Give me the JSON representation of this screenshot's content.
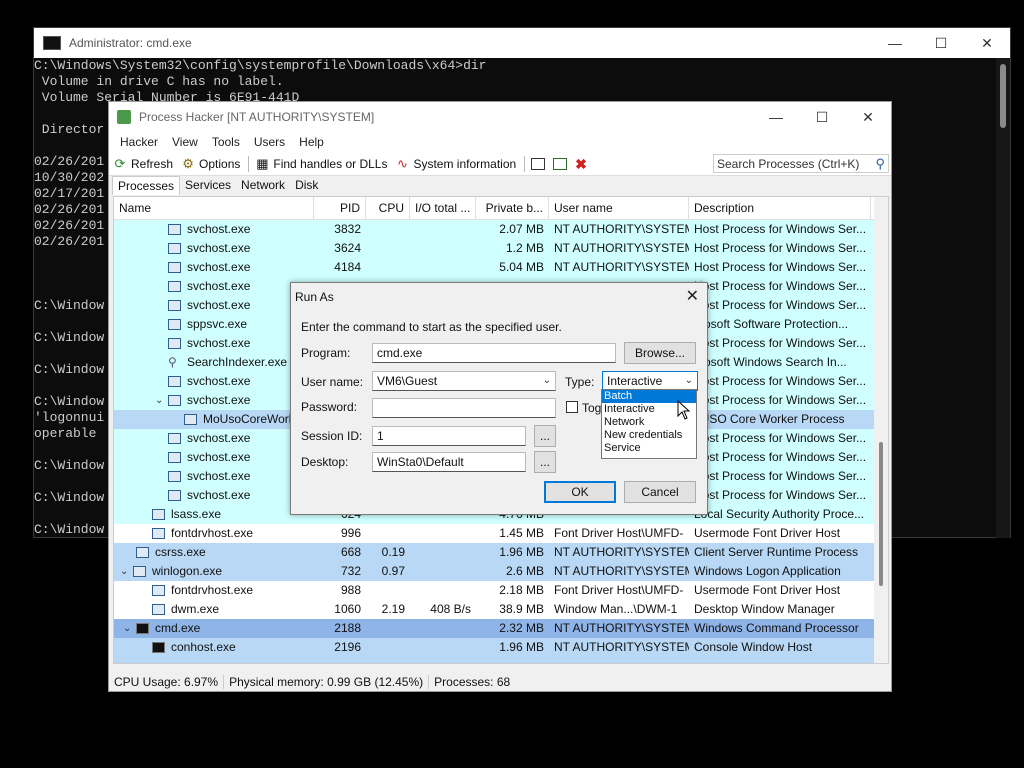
{
  "cmd": {
    "title": "Administrator: cmd.exe",
    "lines": [
      "C:\\Windows\\System32\\config\\systemprofile\\Downloads\\x64>dir",
      " Volume in drive C has no label.",
      " Volume Serial Number is 6E91-441D",
      "",
      " Director",
      "",
      "02/26/201",
      "10/30/202",
      "02/17/201",
      "02/26/201",
      "02/26/201",
      "02/26/201",
      "",
      "",
      "",
      "C:\\Window",
      "",
      "C:\\Window",
      "",
      "C:\\Window",
      "",
      "C:\\Window",
      "'logonnui",
      "operable ",
      "",
      "C:\\Window",
      "",
      "C:\\Window",
      "",
      "C:\\Window"
    ]
  },
  "ph": {
    "title": "Process Hacker [NT AUTHORITY\\SYSTEM]",
    "menu": [
      "Hacker",
      "View",
      "Tools",
      "Users",
      "Help"
    ],
    "toolbar": {
      "refresh": "Refresh",
      "options": "Options",
      "find_handles": "Find handles or DLLs",
      "system_info": "System information"
    },
    "search_placeholder": "Search Processes (Ctrl+K)",
    "tabs": [
      "Processes",
      "Services",
      "Network",
      "Disk"
    ],
    "columns": [
      "Name",
      "PID",
      "CPU",
      "I/O total ...",
      "Private b...",
      "User name",
      "Description"
    ],
    "rows": [
      {
        "name": "svchost.exe",
        "pid": "3832",
        "cpu": "",
        "io": "",
        "priv": "2.07 MB",
        "user": "NT AUTHORITY\\SYSTEM",
        "desc": "Host Process for Windows Ser...",
        "indent": 3,
        "bg": "#cfffff",
        "icon": "box"
      },
      {
        "name": "svchost.exe",
        "pid": "3624",
        "cpu": "",
        "io": "",
        "priv": "1.2 MB",
        "user": "NT AUTHORITY\\SYSTEM",
        "desc": "Host Process for Windows Ser...",
        "indent": 3,
        "bg": "#cfffff",
        "icon": "box"
      },
      {
        "name": "svchost.exe",
        "pid": "4184",
        "cpu": "",
        "io": "",
        "priv": "5.04 MB",
        "user": "NT AUTHORITY\\SYSTEM",
        "desc": "Host Process for Windows Ser...",
        "indent": 3,
        "bg": "#cfffff",
        "icon": "box"
      },
      {
        "name": "svchost.exe",
        "pid": "",
        "cpu": "",
        "io": "",
        "priv": "",
        "user": "",
        "desc": "Host Process for Windows Ser...",
        "indent": 3,
        "bg": "#cfffff",
        "icon": "box"
      },
      {
        "name": "svchost.exe",
        "pid": "",
        "cpu": "",
        "io": "",
        "priv": "",
        "user": "",
        "desc": "Host Process for Windows Ser...",
        "indent": 3,
        "bg": "#cfffff",
        "icon": "box"
      },
      {
        "name": "sppsvc.exe",
        "pid": "",
        "cpu": "",
        "io": "",
        "priv": "",
        "user": "",
        "desc": "crosoft Software Protection...",
        "indent": 3,
        "bg": "#cfffff",
        "icon": "box"
      },
      {
        "name": "svchost.exe",
        "pid": "",
        "cpu": "",
        "io": "",
        "priv": "",
        "user": "",
        "desc": "Host Process for Windows Ser...",
        "indent": 3,
        "bg": "#cfffff",
        "icon": "box"
      },
      {
        "name": "SearchIndexer.exe",
        "pid": "",
        "cpu": "",
        "io": "",
        "priv": "",
        "user": "",
        "desc": "crosoft Windows Search In...",
        "indent": 3,
        "bg": "#cfffff",
        "icon": "mag"
      },
      {
        "name": "svchost.exe",
        "pid": "",
        "cpu": "",
        "io": "",
        "priv": "",
        "user": "",
        "desc": "Host Process for Windows Ser...",
        "indent": 3,
        "bg": "#cfffff",
        "icon": "box"
      },
      {
        "name": "svchost.exe",
        "pid": "",
        "cpu": "",
        "io": "",
        "priv": "",
        "user": "",
        "desc": "Host Process for Windows Ser...",
        "indent": 3,
        "bg": "#cfffff",
        "icon": "box",
        "expanded": true
      },
      {
        "name": "MoUsoCoreWork",
        "pid": "",
        "cpu": "",
        "io": "",
        "priv": "",
        "user": "",
        "desc": "oUSO Core Worker Process",
        "indent": 4,
        "bg": "#b8d8f5",
        "icon": "box"
      },
      {
        "name": "svchost.exe",
        "pid": "",
        "cpu": "",
        "io": "",
        "priv": "",
        "user": "",
        "desc": "Host Process for Windows Ser...",
        "indent": 3,
        "bg": "#cfffff",
        "icon": "box"
      },
      {
        "name": "svchost.exe",
        "pid": "",
        "cpu": "",
        "io": "",
        "priv": "",
        "user": "",
        "desc": "Host Process for Windows Ser...",
        "indent": 3,
        "bg": "#cfffff",
        "icon": "box"
      },
      {
        "name": "svchost.exe",
        "pid": "",
        "cpu": "",
        "io": "",
        "priv": "",
        "user": "",
        "desc": "Host Process for Windows Ser...",
        "indent": 3,
        "bg": "#cfffff",
        "icon": "box"
      },
      {
        "name": "svchost.exe",
        "pid": "",
        "cpu": "",
        "io": "",
        "priv": "",
        "user": "",
        "desc": "Host Process for Windows Ser...",
        "indent": 3,
        "bg": "#cfffff",
        "icon": "box"
      },
      {
        "name": "lsass.exe",
        "pid": "624",
        "cpu": "",
        "io": "",
        "priv": "4.76 MB",
        "user": "",
        "desc": "Local Security Authority Proce...",
        "indent": 2,
        "bg": "#cfffff",
        "icon": "box"
      },
      {
        "name": "fontdrvhost.exe",
        "pid": "996",
        "cpu": "",
        "io": "",
        "priv": "1.45 MB",
        "user": "Font Driver Host\\UMFD-",
        "desc": "Usermode Font Driver Host",
        "indent": 2,
        "bg": "#ffffff",
        "icon": "box"
      },
      {
        "name": "csrss.exe",
        "pid": "668",
        "cpu": "0.19",
        "io": "",
        "priv": "1.96 MB",
        "user": "NT AUTHORITY\\SYSTEM",
        "desc": "Client Server Runtime Process",
        "indent": 1,
        "bg": "#b8d8f5",
        "icon": "box"
      },
      {
        "name": "winlogon.exe",
        "pid": "732",
        "cpu": "0.97",
        "io": "",
        "priv": "2.6 MB",
        "user": "NT AUTHORITY\\SYSTEM",
        "desc": "Windows Logon Application",
        "indent": 0,
        "bg": "#b8d8f5",
        "icon": "box",
        "expanded": true
      },
      {
        "name": "fontdrvhost.exe",
        "pid": "988",
        "cpu": "",
        "io": "",
        "priv": "2.18 MB",
        "user": "Font Driver Host\\UMFD-",
        "desc": "Usermode Font Driver Host",
        "indent": 2,
        "bg": "#ffffff",
        "icon": "box"
      },
      {
        "name": "dwm.exe",
        "pid": "1060",
        "cpu": "2.19",
        "io": "408 B/s",
        "priv": "38.9 MB",
        "user": "Window Man...\\DWM-1",
        "desc": "Desktop Window Manager",
        "indent": 2,
        "bg": "#ffffff",
        "icon": "box"
      },
      {
        "name": "cmd.exe",
        "pid": "2188",
        "cpu": "",
        "io": "",
        "priv": "2.32 MB",
        "user": "NT AUTHORITY\\SYSTEM",
        "desc": "Windows Command Processor",
        "indent": 1,
        "bg": "#8fb4e8",
        "icon": "dark",
        "expanded": true
      },
      {
        "name": "conhost.exe",
        "pid": "2196",
        "cpu": "",
        "io": "",
        "priv": "1.96 MB",
        "user": "NT AUTHORITY\\SYSTEM",
        "desc": "Console Window Host",
        "indent": 2,
        "bg": "#b8d8f5",
        "icon": "dark"
      },
      {
        "name": "",
        "pid": "",
        "cpu": "",
        "io": "",
        "priv": "",
        "user": "",
        "desc": "",
        "indent": 2,
        "bg": "#b8d8f5",
        "icon": "none"
      }
    ],
    "status": {
      "cpu": "CPU Usage: 6.97%",
      "mem": "Physical memory: 0.99 GB (12.45%)",
      "procs": "Processes: 68"
    }
  },
  "runas": {
    "title": "Run As",
    "instruction": "Enter the command to start as the specified user.",
    "program_label": "Program:",
    "program_value": "cmd.exe",
    "browse": "Browse...",
    "username_label": "User name:",
    "username_value": "VM6\\Guest",
    "type_label": "Type:",
    "type_value": "Interactive",
    "password_label": "Password:",
    "toggle_label": "Togg",
    "session_label": "Session ID:",
    "session_value": "1",
    "desktop_label": "Desktop:",
    "desktop_value": "WinSta0\\Default",
    "ellipsis": "...",
    "ok": "OK",
    "cancel": "Cancel",
    "type_options": [
      "Batch",
      "Interactive",
      "Network",
      "New credentials",
      "Service"
    ],
    "type_highlighted": "Batch"
  },
  "colors": {
    "service_row": "#cfffff",
    "own_row": "#b8d8f5",
    "selected_row": "#8fb4e8",
    "accent": "#0078d7"
  }
}
